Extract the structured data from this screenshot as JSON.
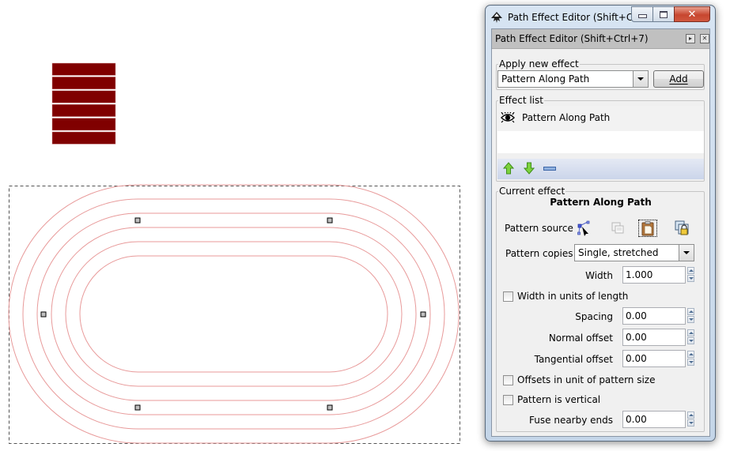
{
  "canvas": {
    "colors": {
      "pattern_fill": "#800000",
      "path_stroke": "#e89a9a",
      "bbox_stroke": "#555555",
      "node_fill": "#bfbfbf"
    },
    "pattern_bar_count": 6,
    "offset_path_count": 6
  },
  "window": {
    "title": "Path Effect Editor (Shift+Ct...",
    "caption_buttons": [
      "minimize",
      "maximize",
      "close"
    ]
  },
  "dock": {
    "title": "Path Effect Editor (Shift+Ctrl+7)"
  },
  "apply_new_effect": {
    "legend": "Apply new effect",
    "selected": "Pattern Along Path",
    "add_label": "Add",
    "add_accel": "A"
  },
  "effect_list": {
    "legend": "Effect list",
    "items": [
      {
        "label": "Pattern Along Path",
        "visible": true
      }
    ],
    "toolbar": [
      "move-up",
      "move-down",
      "remove"
    ]
  },
  "current_effect": {
    "legend": "Current effect",
    "name": "Pattern Along Path",
    "pattern_source_label": "Pattern source",
    "pattern_source_buttons": [
      "edit-on-canvas",
      "copy",
      "paste",
      "link-to-path"
    ],
    "pattern_source_active": "paste",
    "pattern_copies_label": "Pattern copies",
    "pattern_copies_value": "Single, stretched",
    "width_label": "Width",
    "width_value": "1.000",
    "width_in_units_label": "Width in units of length",
    "width_in_units_checked": false,
    "spacing_label": "Spacing",
    "spacing_value": "0.00",
    "normal_offset_label": "Normal offset",
    "normal_offset_value": "0.00",
    "tangential_offset_label": "Tangential offset",
    "tangential_offset_value": "0.00",
    "offsets_in_unit_label": "Offsets in unit of pattern size",
    "offsets_in_unit_checked": false,
    "pattern_vertical_label": "Pattern is vertical",
    "pattern_vertical_checked": false,
    "fuse_label": "Fuse nearby ends",
    "fuse_value": "0.00"
  }
}
